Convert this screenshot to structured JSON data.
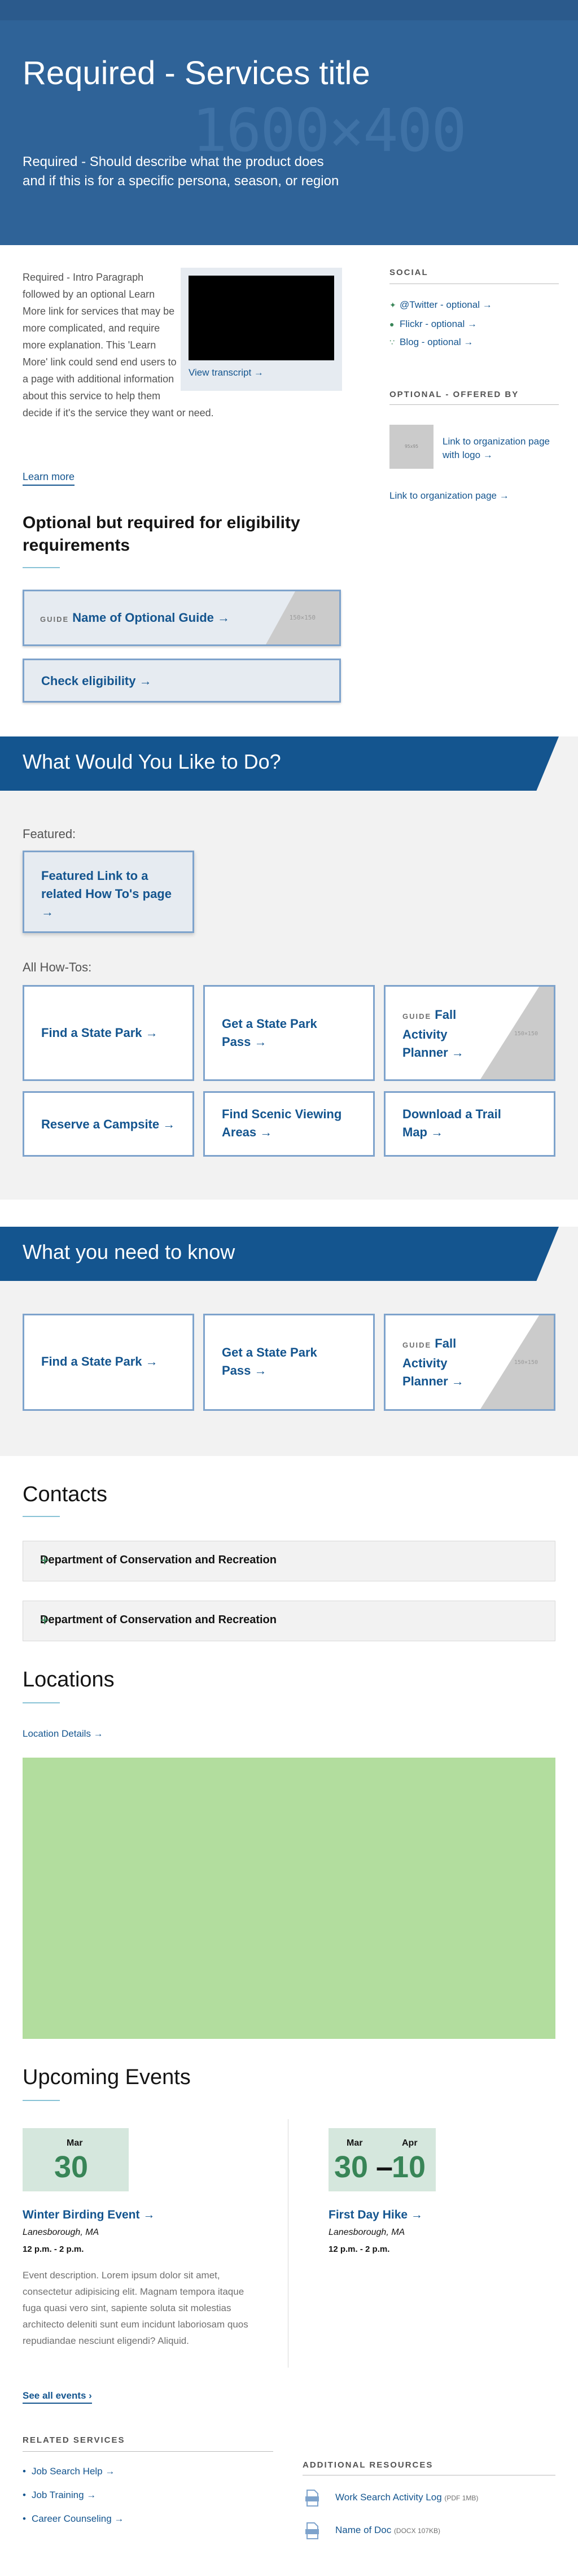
{
  "header": {
    "title": "Required - Services title",
    "description": "Required - Should describe what the product does and if this is for a specific persona, season, or region",
    "image_placeholder": "1600×400"
  },
  "intro": {
    "paragraph": "Required - Intro Paragraph followed by an optional Learn More link for services that may be more complicated, and require more explanation. This 'Learn More' link could send end users to a page with additional information about this service to help them decide if it's the service they want or need.",
    "video_link": "View transcript →",
    "learn_more": "Learn more"
  },
  "sidebar": {
    "social_heading": "SOCIAL",
    "social": [
      {
        "icon": "twitter-icon",
        "label": "@Twitter - optional →"
      },
      {
        "icon": "flickr-icon",
        "label": "Flickr - optional →"
      },
      {
        "icon": "rss-icon",
        "label": "Blog - optional →"
      }
    ],
    "offered_heading": "OPTIONAL - OFFERED BY",
    "logo_placeholder": "95x95",
    "org_logo_link": "Link to organization page with logo →",
    "org_page_link": "Link to organization page →"
  },
  "eligibility": {
    "title": "Optional but required for eligibility requirements",
    "guide_tag": "GUIDE",
    "guide_label": "Name of Optional Guide →",
    "guide_placeholder": "150×150",
    "check_label": "Check eligibility →"
  },
  "what_to_do": {
    "title": "What Would You Like to Do?",
    "featured_label": "Featured:",
    "featured_link": "Featured Link to a related How To's page →",
    "howtos_label": "All How-Tos:",
    "tiles": [
      {
        "label": "Find a State Park →"
      },
      {
        "label": "Get a State Park Pass →"
      },
      {
        "tag": "GUIDE",
        "label": "Fall Activity Planner →",
        "placeholder": "150×150"
      },
      {
        "label": "Reserve a Campsite →"
      },
      {
        "label": "Find Scenic Viewing Areas →"
      },
      {
        "label": "Download a Trail Map →"
      }
    ]
  },
  "need_to_know": {
    "title": "What you need to know",
    "tiles": [
      {
        "label": "Find a State Park →"
      },
      {
        "label": "Get a State Park Pass →"
      },
      {
        "tag": "GUIDE",
        "label": "Fall Activity Planner →",
        "placeholder": "150×150"
      }
    ]
  },
  "contacts": {
    "title": "Contacts",
    "items": [
      {
        "label": "Department of Conservation and Recreation",
        "toggle": "+"
      },
      {
        "label": "Department of Conservation and Recreation",
        "toggle": "+"
      }
    ]
  },
  "locations": {
    "title": "Locations",
    "details_link": "Location Details →"
  },
  "events": {
    "title": "Upcoming Events",
    "items": [
      {
        "month": "Mar",
        "day": "30",
        "title": "Winter Birding Event →",
        "location": "Lanesborough, MA",
        "time": "12 p.m. - 2 p.m.",
        "description": "Event description. Lorem ipsum dolor sit amet, consectetur adipisicing elit. Magnam tempora itaque fuga quasi vero sint, sapiente soluta sit molestias architecto deleniti sunt eum incidunt laboriosam quos repudiandae nesciunt eligendi? Aliquid."
      },
      {
        "month": "Mar",
        "day": "30",
        "month_end": "Apr",
        "day_end": "10",
        "dash": "–",
        "title": "First Day Hike →",
        "location": "Lanesborough, MA",
        "time": "12 p.m. - 2 p.m."
      }
    ],
    "see_all": "See all events ›"
  },
  "related_services": {
    "heading": "RELATED SERVICES",
    "items": [
      "Job Search Help →",
      "Job Training →",
      "Career Counseling →"
    ]
  },
  "additional_resources": {
    "heading": "ADDITIONAL RESOURCES",
    "items": [
      {
        "label": "Work Search Activity Log",
        "meta": "(PDF 1MB)"
      },
      {
        "label": "Name of Doc",
        "meta": "(DOCX 107KB)"
      }
    ]
  },
  "colors": {
    "hero": "#2f6398",
    "primary": "#14558f",
    "accent_green": "#388557",
    "card_bg": "#e6ebf1",
    "card_border": "#7ea3cc",
    "map": "#b2dd9e"
  }
}
